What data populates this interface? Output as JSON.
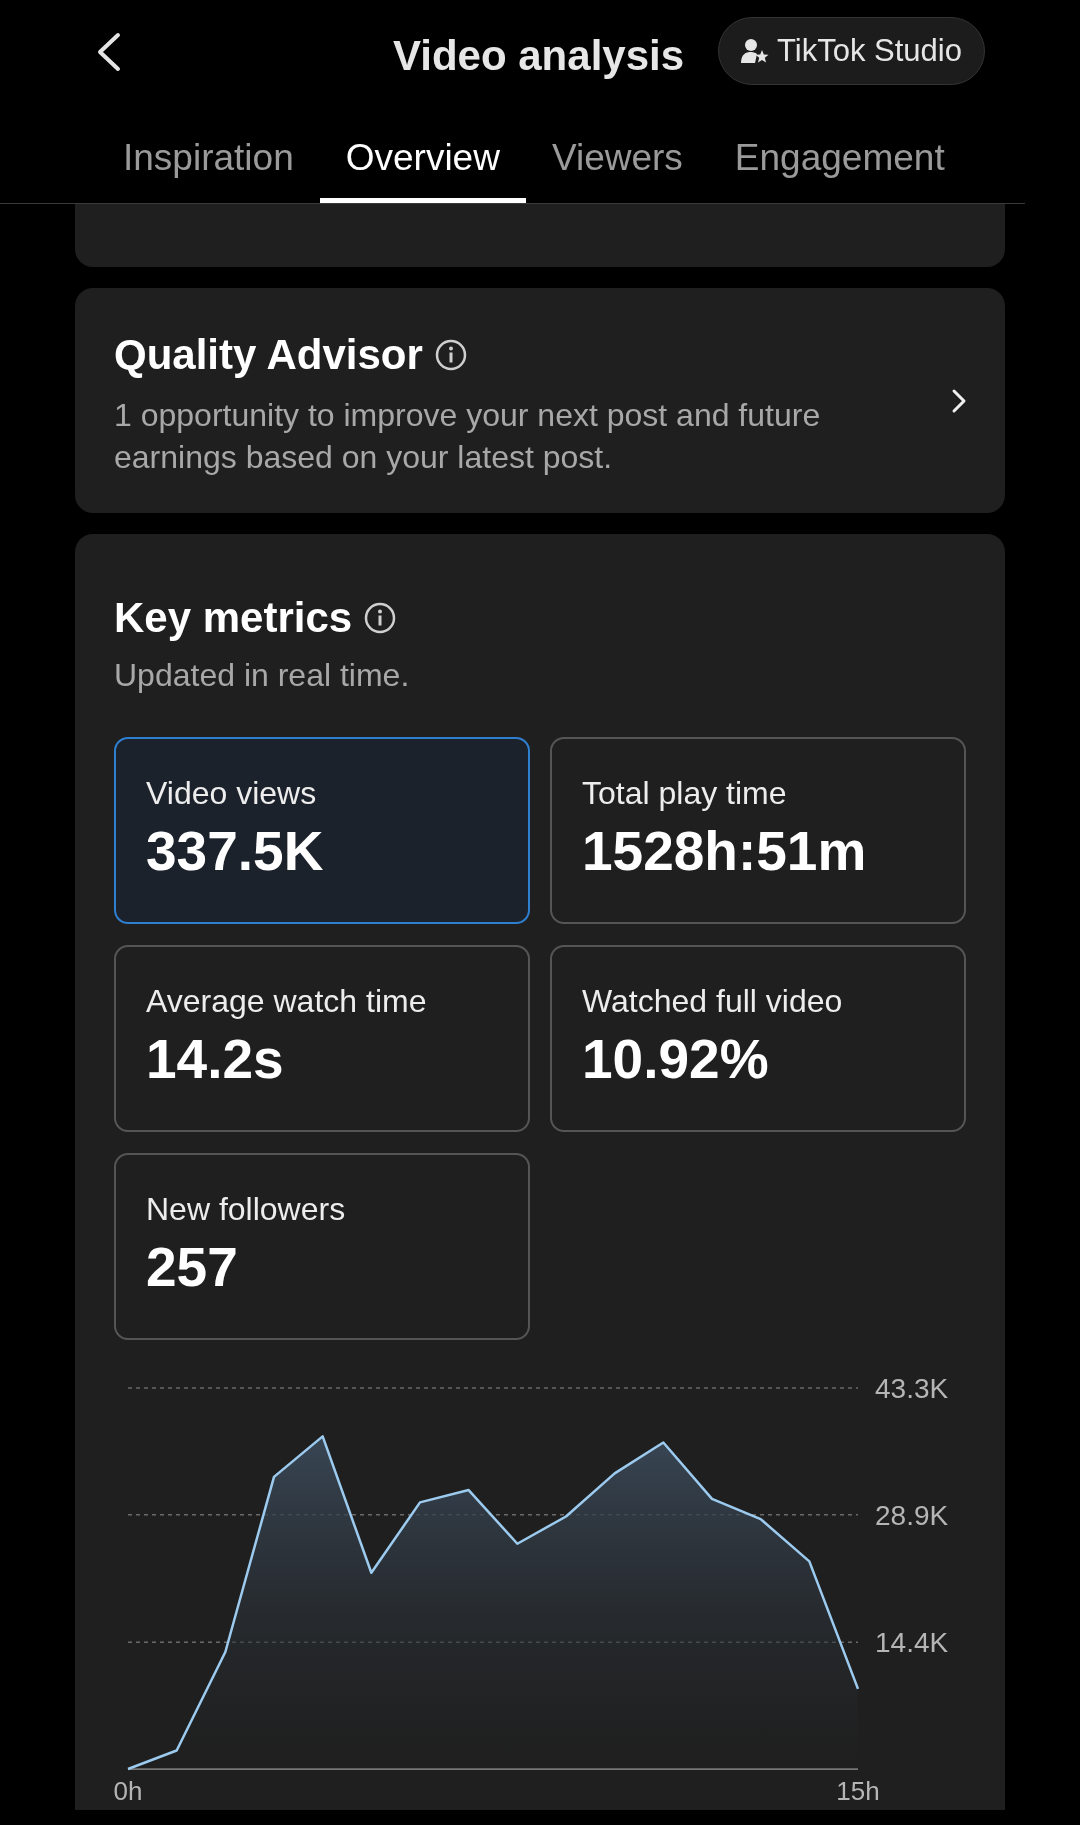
{
  "header": {
    "title": "Video analysis",
    "studio_button": "TikTok Studio"
  },
  "tabs": [
    {
      "label": "Inspiration",
      "selected": false
    },
    {
      "label": "Overview",
      "selected": true
    },
    {
      "label": "Viewers",
      "selected": false
    },
    {
      "label": "Engagement",
      "selected": false
    }
  ],
  "quality_advisor": {
    "title": "Quality Advisor",
    "description": "1 opportunity to improve your next post and future earnings based on your latest post."
  },
  "key_metrics": {
    "title": "Key metrics",
    "subtitle": "Updated in real time.",
    "metrics": [
      {
        "label": "Video views",
        "value": "337.5K",
        "selected": true
      },
      {
        "label": "Total play time",
        "value": "1528h:51m",
        "selected": false
      },
      {
        "label": "Average watch time",
        "value": "14.2s",
        "selected": false
      },
      {
        "label": "Watched full video",
        "value": "10.92%",
        "selected": false
      },
      {
        "label": "New followers",
        "value": "257",
        "selected": false
      }
    ],
    "chart_data": {
      "type": "area",
      "x": [
        0,
        1,
        2,
        3,
        4,
        5,
        6,
        7,
        8,
        9,
        10,
        11,
        12,
        13,
        14,
        15
      ],
      "series": [
        {
          "color": "#9ccbef",
          "values": [
            0,
            2100,
            13300,
            33200,
            37800,
            22300,
            30300,
            31700,
            25600,
            28700,
            33600,
            37100,
            30700,
            28400,
            23600,
            9100
          ]
        }
      ],
      "xlim": [
        0,
        15
      ],
      "ylim": [
        0,
        43300
      ],
      "xticks": [
        {
          "value": 0,
          "label": "0h"
        },
        {
          "value": 15,
          "label": "15h"
        }
      ],
      "yticks": [
        {
          "value": 14400,
          "label": "14.4K"
        },
        {
          "value": 28900,
          "label": "28.9K"
        },
        {
          "value": 43300,
          "label": "43.3K"
        }
      ]
    }
  }
}
